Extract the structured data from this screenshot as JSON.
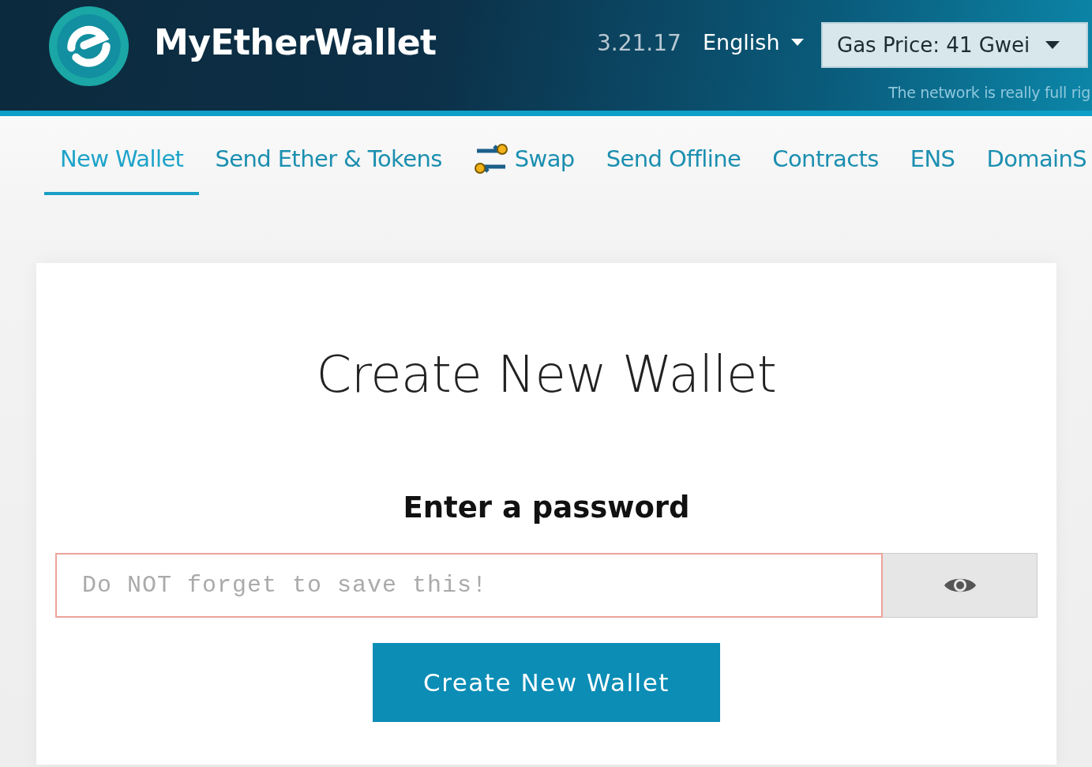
{
  "header": {
    "brand": "MyEtherWallet",
    "version": "3.21.17",
    "language": "English",
    "gas_price": "Gas Price: 41 Gwei",
    "network_notice": "The network is really full rig"
  },
  "tabs": [
    {
      "label": "New Wallet",
      "selected": true
    },
    {
      "label": "Send Ether & Tokens",
      "selected": false
    },
    {
      "label": "Swap",
      "selected": false,
      "kind": "icon"
    },
    {
      "label": "Send Offline",
      "selected": false
    },
    {
      "label": "Contracts",
      "selected": false
    },
    {
      "label": "ENS",
      "selected": false
    },
    {
      "label": "DomainS",
      "selected": false
    }
  ],
  "card": {
    "title": "Create New Wallet",
    "password_label": "Enter a password",
    "password_field": {
      "placeholder": "Do NOT forget to save this!"
    },
    "button": "Create New Wallet"
  }
}
